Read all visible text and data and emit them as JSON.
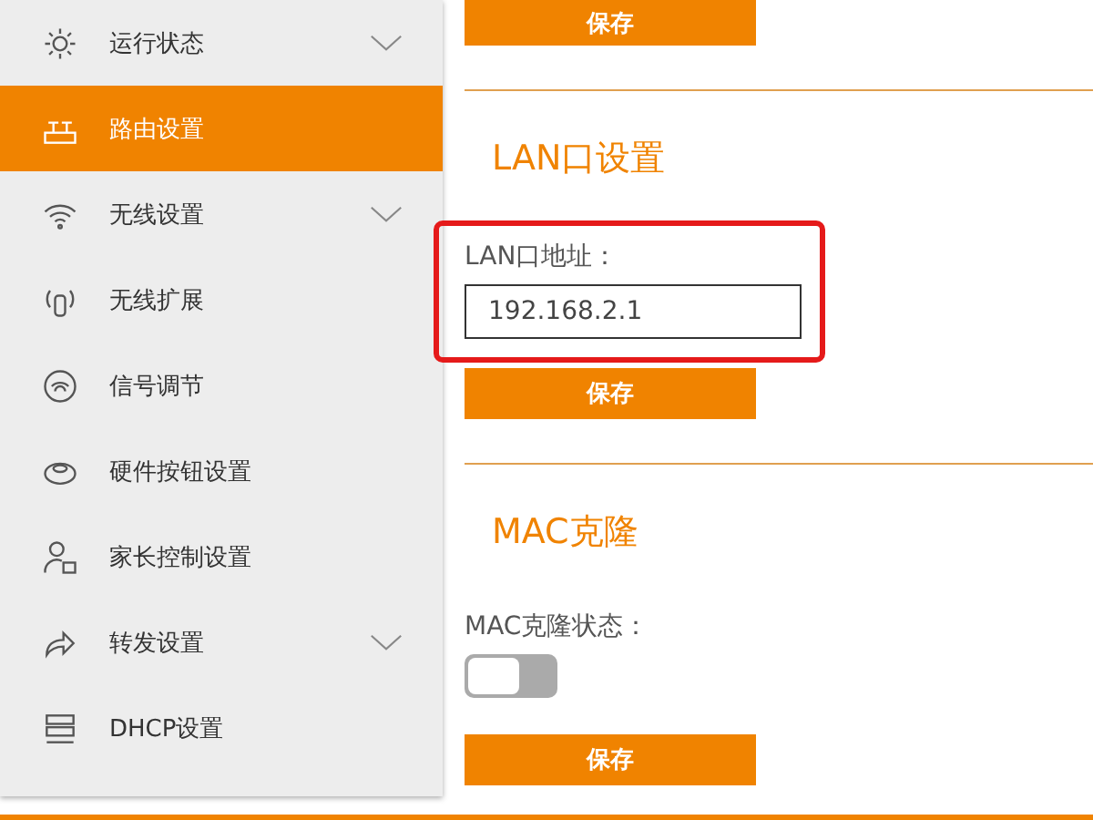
{
  "sidebar": {
    "items": [
      {
        "label": "运行状态",
        "selected": false,
        "expandable": true
      },
      {
        "label": "路由设置",
        "selected": true,
        "expandable": false
      },
      {
        "label": "无线设置",
        "selected": false,
        "expandable": true
      },
      {
        "label": "无线扩展",
        "selected": false,
        "expandable": false
      },
      {
        "label": "信号调节",
        "selected": false,
        "expandable": false
      },
      {
        "label": "硬件按钮设置",
        "selected": false,
        "expandable": false
      },
      {
        "label": "家长控制设置",
        "selected": false,
        "expandable": false
      },
      {
        "label": "转发设置",
        "selected": false,
        "expandable": true
      },
      {
        "label": "DHCP设置",
        "selected": false,
        "expandable": false
      }
    ]
  },
  "top_button": "保存",
  "sections": [
    {
      "title": "LAN口设置",
      "fields": [
        {
          "kind": "input",
          "label": "LAN口地址：",
          "value": "192.168.2.1",
          "highlighted": true
        }
      ],
      "button": "保存"
    },
    {
      "title": "MAC克隆",
      "fields": [
        {
          "kind": "toggle",
          "label": "MAC克隆状态：",
          "on": false,
          "highlighted": false
        }
      ],
      "button": "保存"
    }
  ]
}
